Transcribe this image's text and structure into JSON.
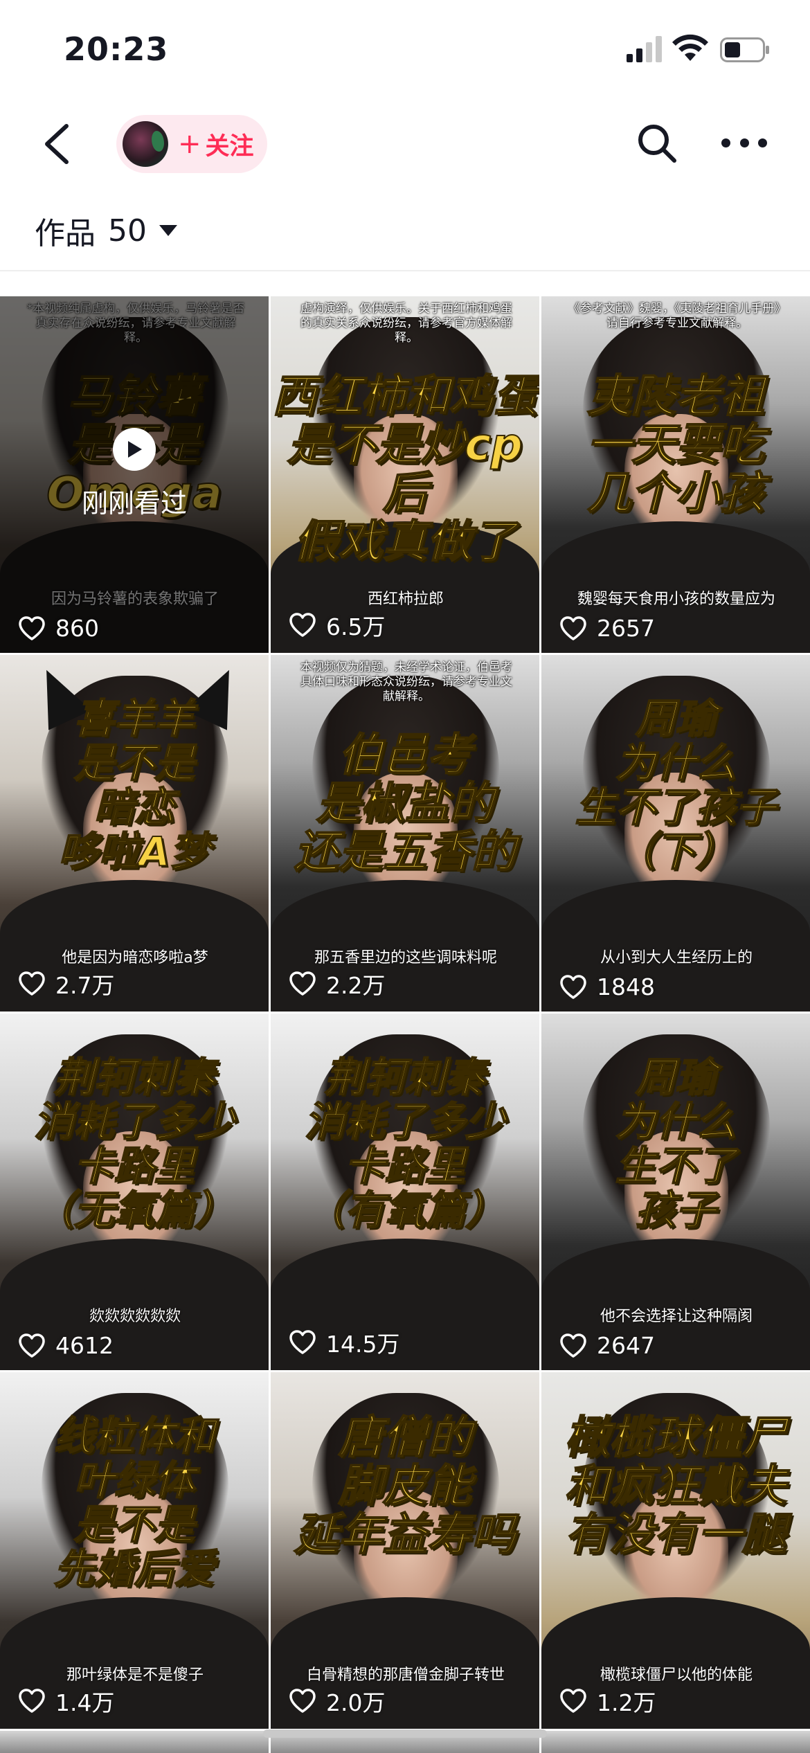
{
  "status_bar": {
    "time": "20:23"
  },
  "header": {
    "follow_label": "关注",
    "follow_plus": "+"
  },
  "works": {
    "label": "作品",
    "count": "50"
  },
  "grid": [
    {
      "title": "马铃薯\n是不是\nOmega",
      "likes": "860",
      "disclaimer": "*本视频纯属虚构，仅供娱乐，马铃薯是否真实存在众说纷纭，请参考专业文献解释。",
      "subtitle": "因为马铃薯的表象欺骗了",
      "watched": true,
      "watched_label": "刚刚看过",
      "bg": "bg-a"
    },
    {
      "title": "西红柿和鸡蛋\n是不是炒cp后\n假戏真做了",
      "likes": "6.5万",
      "disclaimer": "虚构演绎，仅供娱乐。关于西红柿和鸡蛋的真实关系众说纷纭，请参考官方媒体解释。",
      "subtitle": "西红柿拉郎",
      "watched": false,
      "bg": "bg-b"
    },
    {
      "title": "夷陵老祖\n一天要吃\n几个小孩",
      "likes": "2657",
      "disclaimer": "《参考文献》魏婴，《夷陵老祖育儿手册》请自行参考专业文献解释。",
      "subtitle": "魏婴每天食用小孩的数量应为",
      "watched": false,
      "bg": "bg-c"
    },
    {
      "title": "喜羊羊\n是不是\n暗恋\n哆啦A梦",
      "likes": "2.7万",
      "disclaimer": "",
      "subtitle": "他是因为暗恋哆啦a梦",
      "watched": false,
      "bg": "bg-a",
      "ears": true
    },
    {
      "title": "伯邑考\n是椒盐的\n还是五香的",
      "likes": "2.2万",
      "disclaimer": "本视频仅为猜题，未经学术论证，伯邑考具体口味和形态众说纷纭，请参考专业文献解释。",
      "subtitle": "那五香里边的这些调味料呢",
      "watched": false,
      "bg": "bg-c"
    },
    {
      "title": "周瑜\n为什么\n生不了孩子\n（下）",
      "likes": "1848",
      "disclaimer": "",
      "subtitle": "从小到大人生经历上的",
      "watched": false,
      "bg": "bg-c"
    },
    {
      "title": "荆轲刺秦\n消耗了多少\n卡路里\n（无氧篇）",
      "likes": "4612",
      "disclaimer": "",
      "subtitle": "欻欻欻欻欻欻",
      "watched": false,
      "bg": "bg-d"
    },
    {
      "title": "荆轲刺秦\n消耗了多少\n卡路里\n（有氧篇）",
      "likes": "14.5万",
      "disclaimer": "",
      "subtitle": "",
      "watched": false,
      "bg": "bg-d"
    },
    {
      "title": "周瑜\n为什么\n生不了\n孩子",
      "likes": "2647",
      "disclaimer": "",
      "subtitle": "他不会选择让这种隔阂",
      "watched": false,
      "bg": "bg-c"
    },
    {
      "title": "线粒体和\n叶绿体\n是不是\n先婚后爱",
      "likes": "1.4万",
      "disclaimer": "",
      "subtitle": "那叶绿体是不是傻子",
      "watched": false,
      "bg": "bg-d"
    },
    {
      "title": "唐僧的\n脚皮能\n延年益寿吗",
      "likes": "2.0万",
      "disclaimer": "",
      "subtitle": "白骨精想的那唐僧金脚子转世",
      "watched": false,
      "bg": "bg-a"
    },
    {
      "title": "橄榄球僵尸\n和疯狂戴夫\n有没有一腿",
      "likes": "1.2万",
      "disclaimer": "",
      "subtitle": "橄榄球僵尸以他的体能",
      "watched": false,
      "bg": "bg-b"
    }
  ],
  "colors": {
    "accent": "#fe2c55",
    "title_yellow": "#f7d245",
    "pill_bg": "#fde9ef"
  }
}
